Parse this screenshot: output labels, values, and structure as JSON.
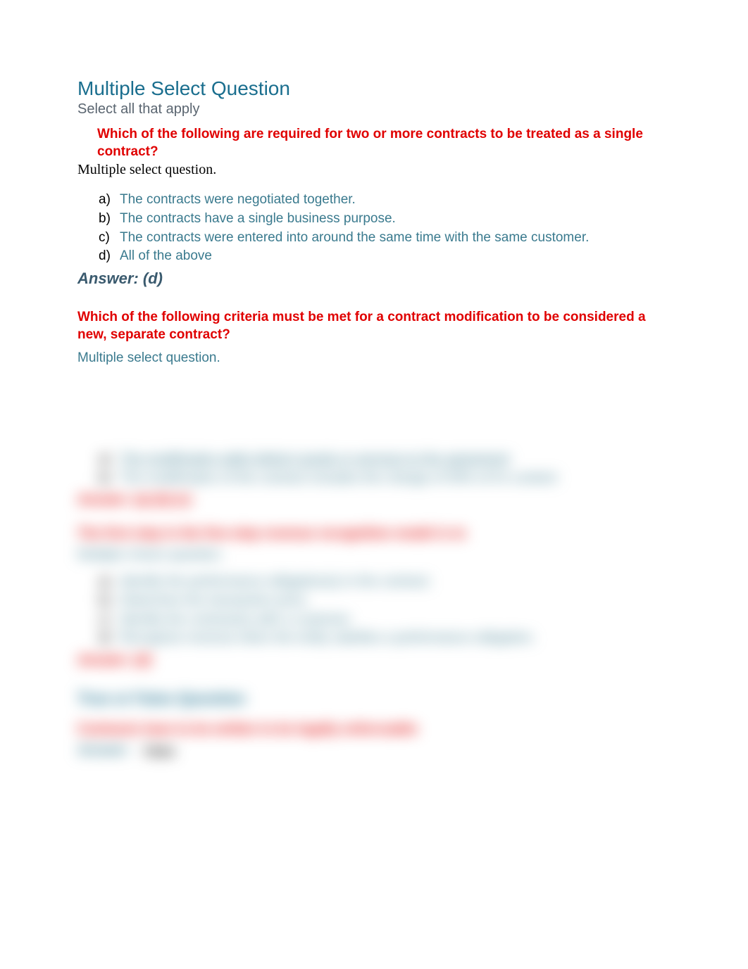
{
  "header": {
    "title": "Multiple Select Question",
    "subtitle": "Select all that apply"
  },
  "question1": {
    "prompt": "Which of the following are required for two or more contracts to be treated as a single contract?",
    "msq_label": "Multiple select question.",
    "options": [
      {
        "letter": "a)",
        "text": "The contracts were negotiated together."
      },
      {
        "letter": "b)",
        "text": "The contracts have a single business purpose."
      },
      {
        "letter": "c)",
        "text": "The contracts were entered into around the same time with the same customer."
      },
      {
        "letter": "d)",
        "text": "All of the above"
      }
    ],
    "answer_label": "Answer: (d)"
  },
  "question2": {
    "prompt": "Which of the following criteria must be met for a contract modification to be considered a new, separate contract?",
    "msq_label": "Multiple select question."
  },
  "blurred": {
    "q2_options": [
      {
        "letter": "a)",
        "text": "The modification adds distinct goods or services to the agreement",
        "underline": true
      },
      {
        "letter": "b)",
        "text": "The modification of the contract includes the change of 50% of it's content",
        "underline": false
      }
    ],
    "q2_answer": "Answer: (a) (b) (c)",
    "q3_prompt": "The first step in the five-step revenue recognition model is to",
    "q3_msq": "Multiple choice question.",
    "q3_options": [
      {
        "letter": "a)",
        "text": "Identify the performance obligation(s) in the contract."
      },
      {
        "letter": "b)",
        "text": "Determine the transaction price."
      },
      {
        "letter": "c)",
        "text": "Identify the contract(s) with a customer."
      },
      {
        "letter": "d)",
        "text": "Recognize revenue when the entity satisfies a performance obligation."
      }
    ],
    "q3_answer": "Answer: (d)",
    "tf_header": "True or False Question",
    "tf_prompt": "Contracts have to be written to be legally enforceable",
    "tf_answer_label": "Answer:",
    "tf_answer_value": "False"
  }
}
